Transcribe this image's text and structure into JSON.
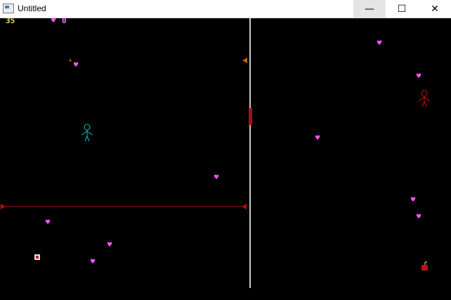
{
  "window": {
    "title": "Untitled",
    "minimize_glyph": "—",
    "maximize_glyph": "☐",
    "close_glyph": "✕"
  },
  "hud": {
    "score": "35",
    "hearts": "0"
  },
  "icons": {
    "heart": "♥",
    "app": "app-window-icon"
  },
  "colors": {
    "background": "#000000",
    "divider": "#c0c0c0",
    "player": "#00c8d0",
    "enemy": "#d01010",
    "heart": "#ff55ff",
    "score": "#f0e060",
    "laser": "#aa1010",
    "arrow": "#c06010"
  },
  "entities": {
    "heart_count": 11
  }
}
